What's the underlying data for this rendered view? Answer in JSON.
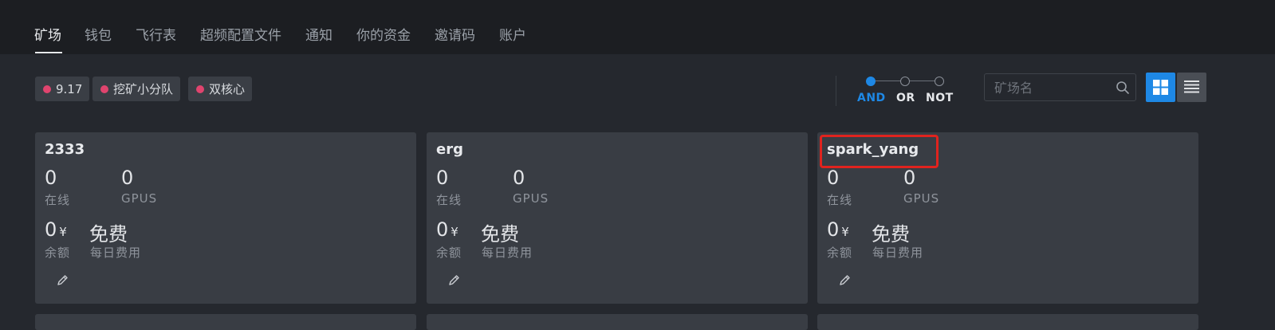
{
  "nav": {
    "tabs": [
      "矿场",
      "钱包",
      "飞行表",
      "超频配置文件",
      "通知",
      "你的资金",
      "邀请码",
      "账户"
    ],
    "active": 0
  },
  "filters": [
    "9.17",
    "挖矿小分队",
    "双核心"
  ],
  "logic": {
    "options": [
      "AND",
      "OR",
      "NOT"
    ],
    "selected": "AND"
  },
  "search": {
    "placeholder": "矿场名",
    "value": ""
  },
  "view": {
    "modes": [
      "grid-view",
      "list-view"
    ],
    "selected": "grid-view"
  },
  "cards": [
    {
      "name": "2333",
      "online": "0",
      "online_label": "在线",
      "gpus": "0",
      "gpus_label": "GPUS",
      "balance": "0",
      "currency": "¥",
      "balance_label": "余额",
      "daily": "免费",
      "daily_label": "每日费用"
    },
    {
      "name": "erg",
      "online": "0",
      "online_label": "在线",
      "gpus": "0",
      "gpus_label": "GPUS",
      "balance": "0",
      "currency": "¥",
      "balance_label": "余额",
      "daily": "免费",
      "daily_label": "每日费用"
    },
    {
      "name": "spark_yang",
      "online": "0",
      "online_label": "在线",
      "gpus": "0",
      "gpus_label": "GPUS",
      "balance": "0",
      "currency": "¥",
      "balance_label": "余额",
      "daily": "免费",
      "daily_label": "每日费用",
      "highlighted": true
    }
  ],
  "colors": {
    "accent": "#1e88e5",
    "tag_dot": "#e0446e",
    "highlight": "#e0231e"
  },
  "icons": {
    "search": "search-icon",
    "edit": "pencil-icon",
    "grid": "grid-view-icon",
    "list": "list-view-icon"
  }
}
